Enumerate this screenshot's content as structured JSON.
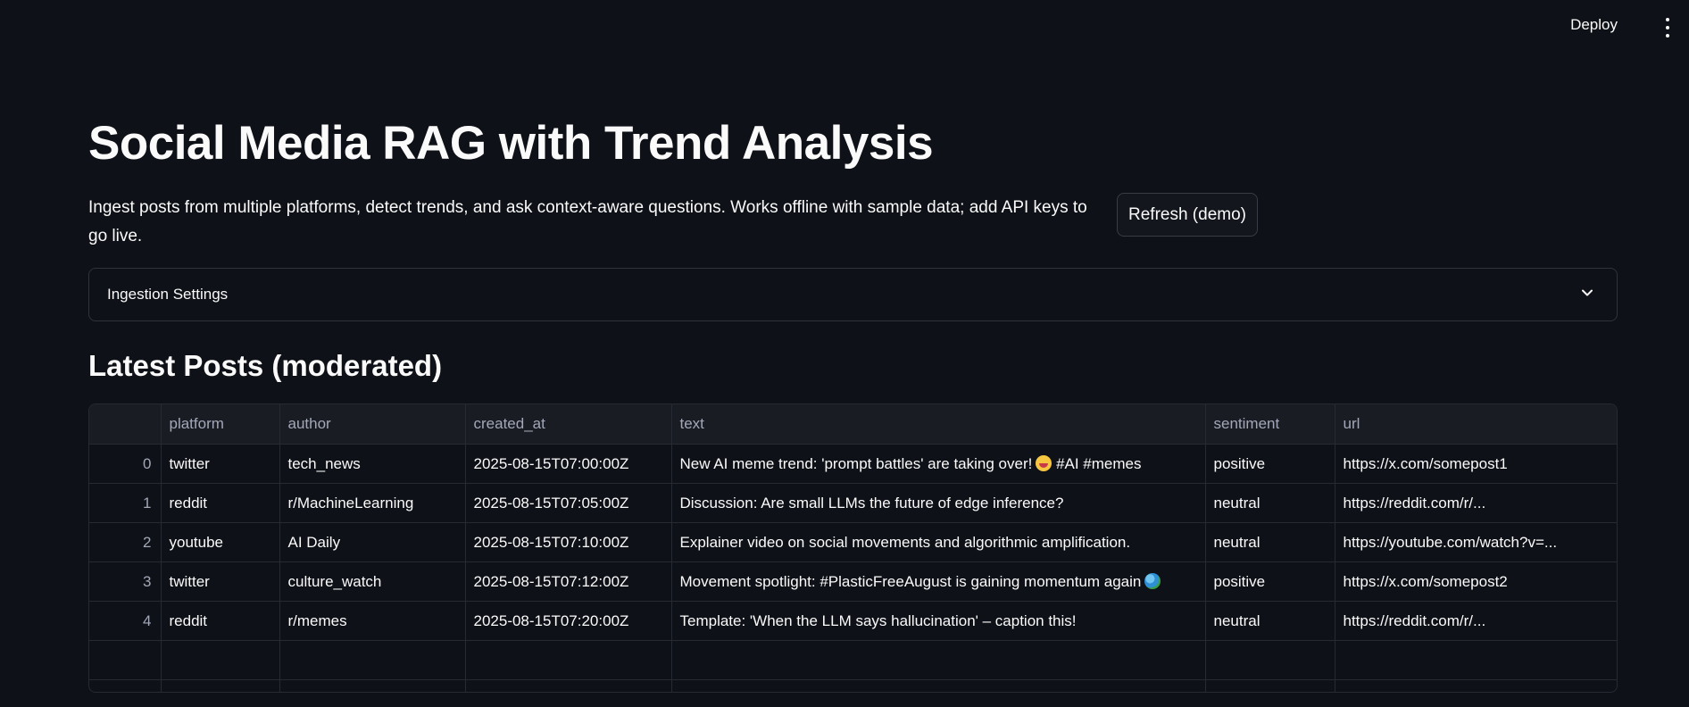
{
  "header": {
    "deploy_label": "Deploy",
    "menu_icon": "kebab-menu-icon"
  },
  "page": {
    "title": "Social Media RAG with Trend Analysis",
    "description": "Ingest posts from multiple platforms, detect trends, and ask context-aware questions. Works offline with sample data; add API keys to go live.",
    "refresh_label": "Refresh (demo)"
  },
  "expander": {
    "label": "Ingestion Settings",
    "icon": "chevron-down-icon",
    "expanded": false
  },
  "posts": {
    "heading": "Latest Posts (moderated)",
    "columns": [
      "",
      "platform",
      "author",
      "created_at",
      "text",
      "sentiment",
      "url"
    ],
    "rows": [
      {
        "index": "0",
        "platform": "twitter",
        "author": "tech_news",
        "created_at": "2025-08-15T07:00:00Z",
        "text": "New AI meme trend: 'prompt battles' are taking over!",
        "text_emoji": "laughing-face-emoji",
        "text_tail": " #AI #memes",
        "sentiment": "positive",
        "url": "https://x.com/somepost1"
      },
      {
        "index": "1",
        "platform": "reddit",
        "author": "r/MachineLearning",
        "created_at": "2025-08-15T07:05:00Z",
        "text": "Discussion: Are small LLMs the future of edge inference?",
        "text_emoji": "",
        "text_tail": "",
        "sentiment": "neutral",
        "url": "https://reddit.com/r/..."
      },
      {
        "index": "2",
        "platform": "youtube",
        "author": "AI Daily",
        "created_at": "2025-08-15T07:10:00Z",
        "text": "Explainer video on social movements and algorithmic amplification.",
        "text_emoji": "",
        "text_tail": "",
        "sentiment": "neutral",
        "url": "https://youtube.com/watch?v=..."
      },
      {
        "index": "3",
        "platform": "twitter",
        "author": "culture_watch",
        "created_at": "2025-08-15T07:12:00Z",
        "text": "Movement spotlight: #PlasticFreeAugust is gaining momentum again",
        "text_emoji": "globe-emoji",
        "text_tail": "",
        "sentiment": "positive",
        "url": "https://x.com/somepost2"
      },
      {
        "index": "4",
        "platform": "reddit",
        "author": "r/memes",
        "created_at": "2025-08-15T07:20:00Z",
        "text": "Template: 'When the LLM says hallucination' – caption this!",
        "text_emoji": "",
        "text_tail": "",
        "sentiment": "neutral",
        "url": "https://reddit.com/r/..."
      }
    ]
  }
}
